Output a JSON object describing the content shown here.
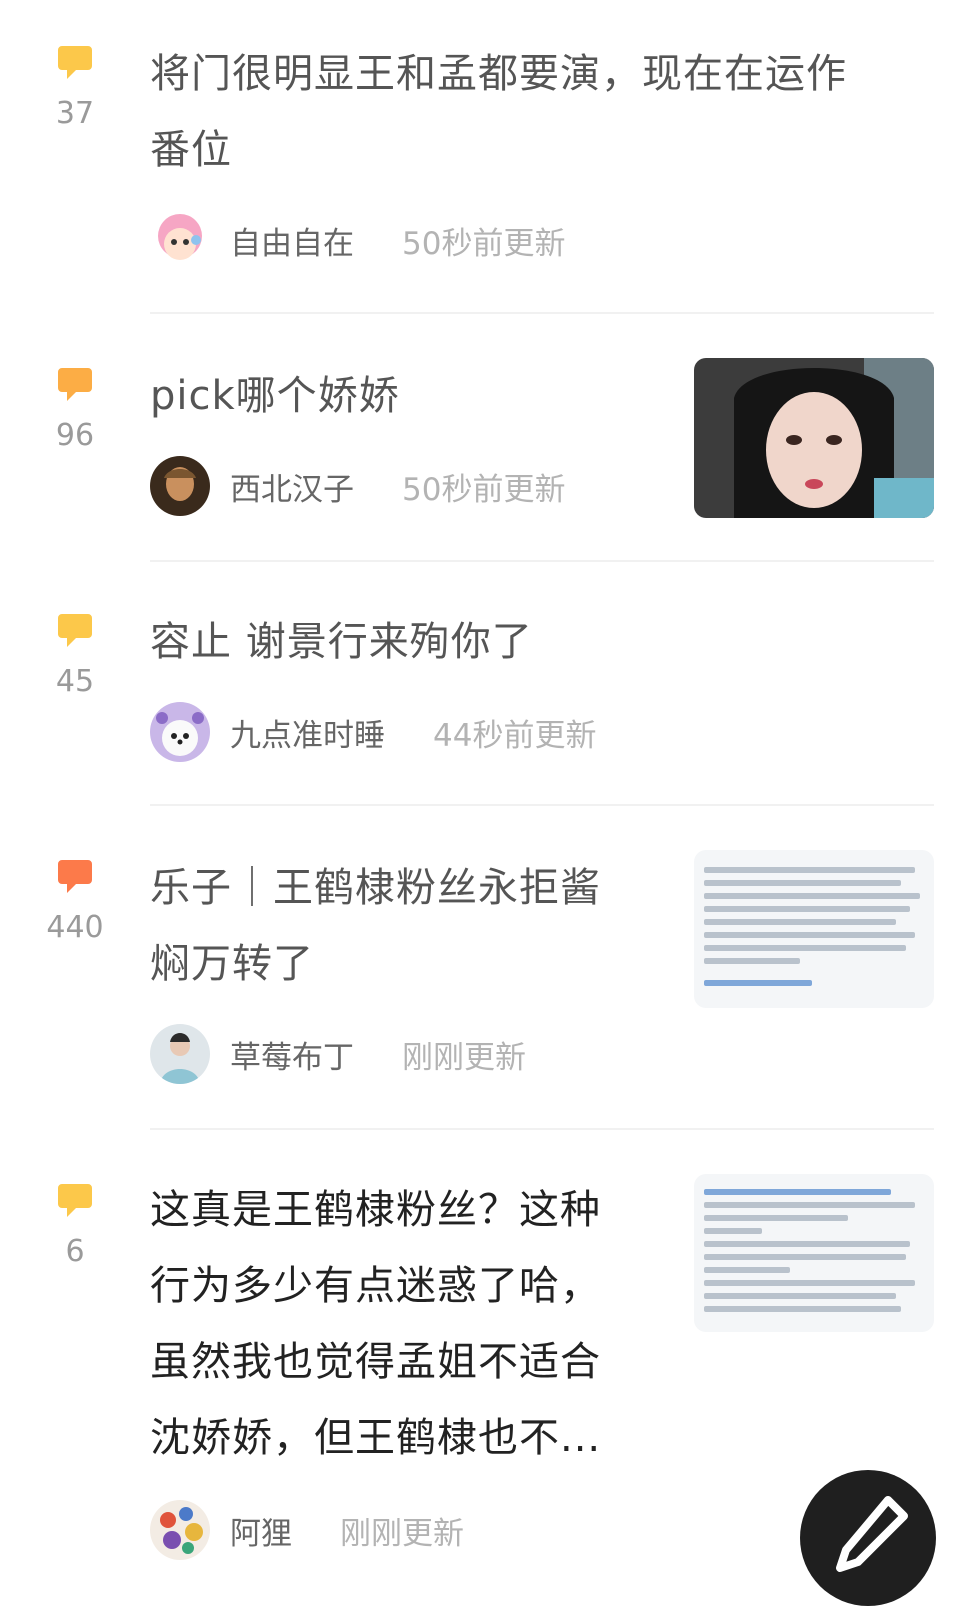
{
  "posts": [
    {
      "count": "37",
      "title_lines": [
        "将门很明显王和孟都要演，现在在运作",
        "番位"
      ],
      "user": "自由自在",
      "time": "50秒前更新",
      "bubble_color": "#fcc84a"
    },
    {
      "count": "96",
      "title_lines": [
        "pick哪个娇娇"
      ],
      "user": "西北汉子",
      "time": "50秒前更新",
      "bubble_color": "#fcad45"
    },
    {
      "count": "45",
      "title_lines": [
        "容止 谢景行来殉你了"
      ],
      "user": "九点准时睡",
      "time": "44秒前更新",
      "bubble_color": "#fcc84a"
    },
    {
      "count": "440",
      "title_lines": [
        "乐子｜王鹤棣粉丝永拒酱",
        "焖万转了"
      ],
      "user": "草莓布丁",
      "time": "刚刚更新",
      "bubble_color": "#fc7a4a"
    },
    {
      "count": "6",
      "title_lines": [
        "这真是王鹤棣粉丝？这种",
        "行为多少有点迷惑了哈，",
        "虽然我也觉得孟姐不适合",
        "沈娇娇，但王鹤棣也不..."
      ],
      "user": "阿狸",
      "time": "刚刚更新",
      "bubble_color": "#fcc84a"
    }
  ],
  "fab": {
    "icon": "pen-icon"
  }
}
